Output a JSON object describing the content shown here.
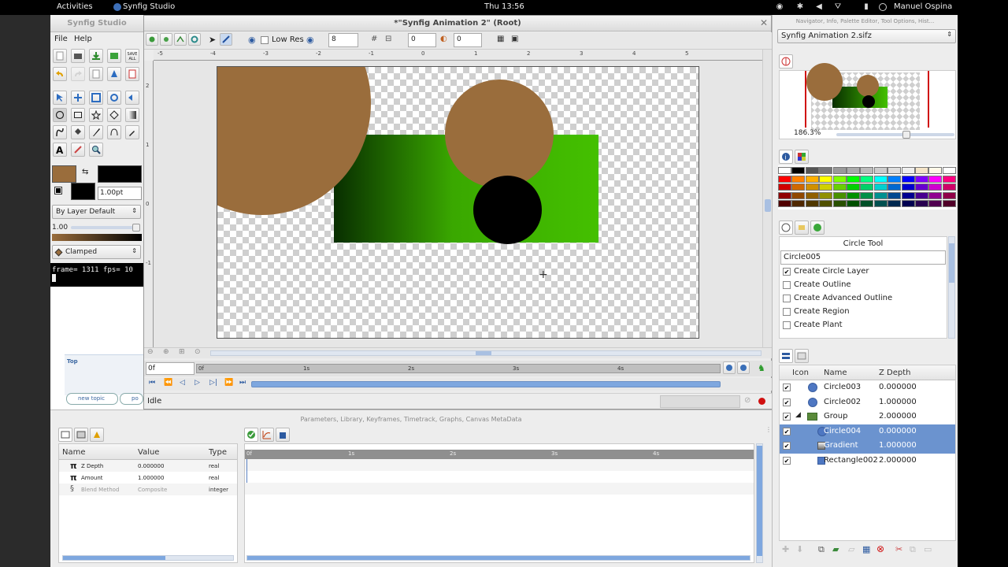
{
  "topbar": {
    "activities": "Activities",
    "app": "Synfig Studio",
    "clock": "Thu 13:56",
    "user": "Manuel Ospina"
  },
  "toolbox": {
    "title": "Synfig Studio",
    "menu": [
      "File",
      "Help"
    ],
    "save_all": "SAVE ALL",
    "width_value": "1.00pt",
    "blend_method": "By Layer Default",
    "opacity_value": "1.00",
    "interpolation": "Clamped"
  },
  "terminal": {
    "line1": "frame= 1311 fps= 10"
  },
  "behind": {
    "top_label": "Top",
    "tab_new_topic": "new topic",
    "tab_po": "po"
  },
  "canvas_window": {
    "title": "*\"Synfig Animation 2\" (Root)",
    "low_res": "Low Res",
    "quality": "8",
    "onion_past": "0",
    "onion_future": "0",
    "ruler_labels": [
      "-5",
      "-4",
      "-3",
      "-2",
      "-1",
      "0",
      "1",
      "2",
      "3",
      "4",
      "5"
    ],
    "vruler_labels": [
      "2",
      "1",
      "0",
      "-1"
    ],
    "time_field": "0f",
    "time_labels": [
      "0f",
      "1s",
      "2s",
      "3s",
      "4s"
    ],
    "status": "Idle"
  },
  "params_panel": {
    "title": "Parameters, Library, Keyframes, Timetrack, Graphs, Canvas MetaData",
    "columns": [
      "Name",
      "Value",
      "Type"
    ],
    "rows": [
      {
        "name": "Z Depth",
        "value": "0.000000",
        "type": "real"
      },
      {
        "name": "Amount",
        "value": "1.000000",
        "type": "real"
      },
      {
        "name": "Blend Method",
        "value": "Composite",
        "type": "integer"
      }
    ],
    "time_labels": [
      "0f",
      "1s",
      "2s",
      "3s",
      "4s"
    ]
  },
  "right_dock": {
    "title": "Navigator, Info, Palette Editor, Tool Options, Hist...",
    "file_select": "Synfig Animation 2.sifz",
    "zoom": "186.3%",
    "tool_title": "Circle Tool",
    "name_field": "Circle005",
    "options": [
      {
        "label": "Create Circle Layer",
        "checked": true
      },
      {
        "label": "Create Outline",
        "checked": false
      },
      {
        "label": "Create Advanced Outline",
        "checked": false
      },
      {
        "label": "Create Region",
        "checked": false
      },
      {
        "label": "Create Plant",
        "checked": false
      }
    ],
    "layers_columns": [
      "Icon",
      "Name",
      "Z Depth"
    ],
    "layers": [
      {
        "name": "Circle003",
        "z": "0.000000",
        "icon": "circle-icon",
        "selected": false
      },
      {
        "name": "Circle002",
        "z": "1.000000",
        "icon": "circle-icon",
        "selected": false
      },
      {
        "name": "Group",
        "z": "2.000000",
        "icon": "folder-icon",
        "selected": false
      },
      {
        "name": "Circle004",
        "z": "0.000000",
        "icon": "circle-icon",
        "selected": true
      },
      {
        "name": "Gradient",
        "z": "1.000000",
        "icon": "gradient-icon",
        "selected": true
      },
      {
        "name": "Rectangle002",
        "z": "2.000000",
        "icon": "rectangle-icon",
        "selected": false
      }
    ]
  },
  "colors": {
    "fill": "#9a6d3c",
    "outline": "#000000",
    "green": "#44c000",
    "selection": "#6b93cf"
  }
}
